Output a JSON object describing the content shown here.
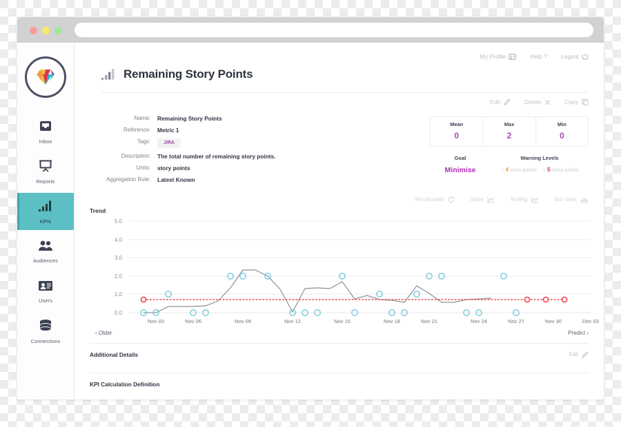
{
  "browser": {
    "dots": [
      "close-red",
      "minimize-yellow",
      "maximize-green"
    ],
    "url": ""
  },
  "sidebar": {
    "logo_name": "diamond-logo",
    "items": [
      {
        "label": "Inbox",
        "icon": "inbox-icon",
        "active": false
      },
      {
        "label": "Reports",
        "icon": "presentation-icon",
        "active": false
      },
      {
        "label": "KPIs",
        "icon": "bar-chart-icon",
        "active": true
      },
      {
        "label": "Audiences",
        "icon": "people-icon",
        "active": false
      },
      {
        "label": "Users",
        "icon": "id-card-icon",
        "active": false
      },
      {
        "label": "Connections",
        "icon": "database-icon",
        "active": false
      }
    ]
  },
  "topbar": {
    "profile": "My Profile",
    "help": "Help ?",
    "logout": "Logout"
  },
  "header": {
    "title": "Remaining Story Points",
    "icon": "bar-chart-icon"
  },
  "actions": {
    "edit": "Edit",
    "delete": "Delete",
    "copy": "Copy"
  },
  "details": {
    "rows": [
      {
        "label": "Name:",
        "value": "Remaining Story Points"
      },
      {
        "label": "Reference:",
        "value": "Metric 1"
      },
      {
        "label": "Tags:",
        "value": "JIRA",
        "is_tag": true
      },
      {
        "label": "Description:",
        "value": "The total number of remaining story points."
      },
      {
        "label": "Units:",
        "value": "story points"
      },
      {
        "label": "Aggregation Rule:",
        "value": "Latest Known"
      }
    ]
  },
  "stats": {
    "cells": [
      {
        "key": "Mean",
        "value": "0"
      },
      {
        "key": "Max",
        "value": "2"
      },
      {
        "key": "Min",
        "value": "0"
      }
    ],
    "goal_label": "Goal",
    "goal_value": "Minimise",
    "warning_label": "Warning Levels",
    "warnings": [
      {
        "op": "<",
        "num": "4",
        "unit": "story points",
        "color": "#f0a020"
      },
      {
        "op": "<",
        "num": "5",
        "unit": "story points",
        "color": "#e03030"
      }
    ]
  },
  "chart_tools": [
    {
      "label": "Recalculate",
      "icon": "refresh-icon"
    },
    {
      "label": "Slope",
      "icon": "line-chart-icon"
    },
    {
      "label": "Rolling",
      "icon": "line-chart-icon"
    },
    {
      "label": "Bar chart",
      "icon": "bar-chart-icon"
    }
  ],
  "chart_title": "Trend",
  "pager": {
    "older": "‹ Older",
    "predict": "Predict ›"
  },
  "sections": [
    {
      "title": "Additional Details",
      "edit": "Edit",
      "has_edit": true
    },
    {
      "title": "KPI Calculation Definition",
      "edit": "",
      "has_edit": false
    }
  ],
  "chart_data": {
    "type": "line",
    "title": "Trend",
    "xlabel": "",
    "ylabel": "",
    "ylim": [
      0,
      5
    ],
    "yticks": [
      0.0,
      1.0,
      2.0,
      3.0,
      4.0,
      5.0
    ],
    "ytick_labels": [
      "0.0",
      "1.0",
      "2.0",
      "3.0",
      "4.0",
      "5.0"
    ],
    "grid": true,
    "legend": "none",
    "xtick_labels": [
      "Nov 03",
      "Nov 06",
      "Nov 09",
      "Nov 12",
      "Nov 15",
      "Nov 18",
      "Nov 21",
      "Nov 24",
      "Nov 27",
      "Nov 30",
      "Dec 03"
    ],
    "x": [
      "Nov 02",
      "Nov 03",
      "Nov 04",
      "Nov 05",
      "Nov 06",
      "Nov 07",
      "Nov 08",
      "Nov 09",
      "Nov 10",
      "Nov 11",
      "Nov 12",
      "Nov 13",
      "Nov 14",
      "Nov 15",
      "Nov 16",
      "Nov 17",
      "Nov 18",
      "Nov 19",
      "Nov 20",
      "Nov 21",
      "Nov 22",
      "Nov 23",
      "Nov 24",
      "Nov 25",
      "Nov 26",
      "Nov 27",
      "Nov 28",
      "Nov 29",
      "Nov 30",
      "Dec 01",
      "Dec 02",
      "Dec 03"
    ],
    "series": [
      {
        "name": "Observed",
        "style": "markers",
        "marker": "open-circle",
        "color": "#7dcbe0",
        "values": [
          0,
          0,
          1,
          0,
          0,
          2,
          2,
          2,
          0,
          0,
          0,
          2,
          0,
          1,
          0,
          0,
          2,
          1,
          2,
          2,
          0,
          0,
          2,
          0,
          0,
          0,
          0,
          2,
          0,
          null,
          null,
          null
        ]
      },
      {
        "name": "Trend line",
        "style": "line",
        "color": "#8a8f98",
        "values": [
          0,
          0,
          0.35,
          0.35,
          0.35,
          0.38,
          0.62,
          1.35,
          2.35,
          2.35,
          2.0,
          1.3,
          0.05,
          1.3,
          1.35,
          1.33,
          1.68,
          0.75,
          0.95,
          0.72,
          0.68,
          0.58,
          1.48,
          1.05,
          0.55,
          0.55,
          0.7,
          0.75,
          0.78,
          null,
          null,
          null
        ]
      },
      {
        "name": "Goal / Prediction",
        "style": "dotted-line",
        "color": "#f0444c",
        "marker": "open-circle",
        "values": [
          0.73,
          0.73,
          0.73,
          0.73,
          0.73,
          0.73,
          0.73,
          0.73,
          0.73,
          0.73,
          0.73,
          0.73,
          0.73,
          0.73,
          0.73,
          0.73,
          0.73,
          0.73,
          0.73,
          0.73,
          0.73,
          0.73,
          0.73,
          0.73,
          0.73,
          0.73,
          0.73,
          0.73,
          0.73,
          0.73,
          0.73,
          0.73
        ],
        "marker_indices": [
          0,
          28,
          30,
          31
        ]
      }
    ]
  },
  "colors": {
    "accent_teal": "#5bbfc4",
    "purple": "#a34ba8",
    "marker_blue": "#7dcbe0",
    "prediction_red": "#f0444c",
    "trend_gray": "#8a8f98"
  }
}
